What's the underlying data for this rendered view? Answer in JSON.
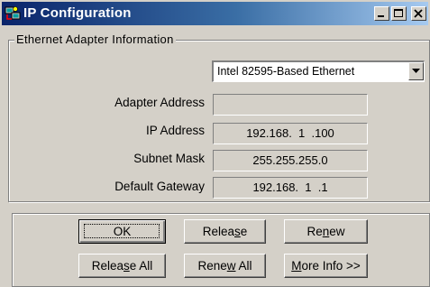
{
  "window": {
    "title": "IP Configuration",
    "controls": [
      "minimize-icon",
      "maximize-icon",
      "close-icon"
    ]
  },
  "group": {
    "label": "Ethernet  Adapter Information"
  },
  "adapter": {
    "selected": "Intel 82595-Based Ethernet"
  },
  "fields": {
    "adapter_address": {
      "label": "Adapter Address",
      "value": ""
    },
    "ip_address": {
      "label": "IP Address",
      "value": "192.168.  1  .100"
    },
    "subnet_mask": {
      "label": "Subnet Mask",
      "value": "255.255.255.0"
    },
    "default_gateway": {
      "label": "Default Gateway",
      "value": "192.168.  1  .1"
    }
  },
  "buttons": {
    "ok": "OK",
    "release": {
      "pre": "Relea",
      "mn": "s",
      "post": "e"
    },
    "renew": {
      "pre": "Re",
      "mn": "n",
      "post": "ew"
    },
    "release_all": {
      "pre": "Relea",
      "mn": "s",
      "post": "e All"
    },
    "renew_all": {
      "pre": "Rene",
      "mn": "w",
      "post": " All"
    },
    "more_info": {
      "pre": "",
      "mn": "M",
      "post": "ore Info >>"
    }
  },
  "colors": {
    "titlebar_start": "#0a246a",
    "titlebar_end": "#a6caf0",
    "face": "#d4d0c8"
  }
}
